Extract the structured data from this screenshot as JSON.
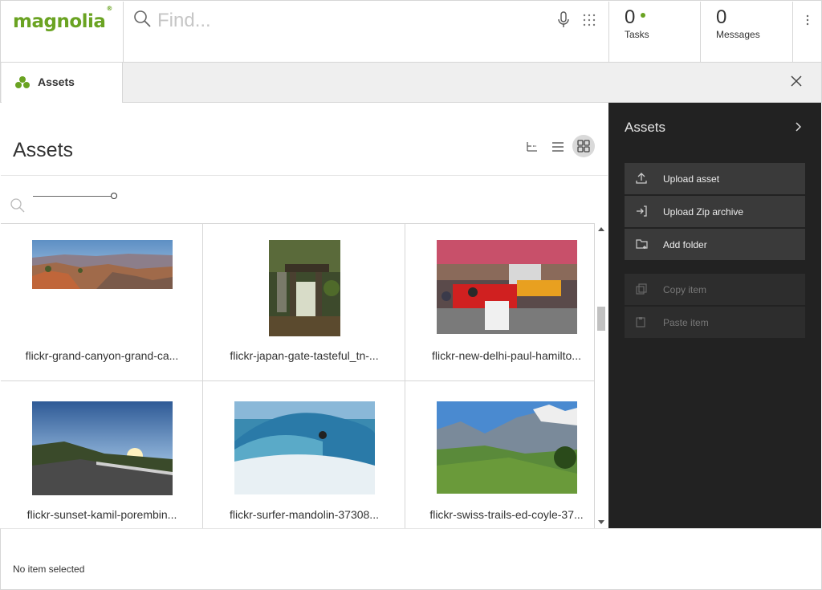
{
  "brand": {
    "logo_text": "magnolia",
    "trademark": "®",
    "accent_color": "#6aa322"
  },
  "search": {
    "placeholder": "Find..."
  },
  "header": {
    "tasks": {
      "count": "0",
      "label": "Tasks"
    },
    "messages": {
      "count": "0",
      "label": "Messages"
    }
  },
  "tab": {
    "label": "Assets",
    "icon": "assets-app-icon"
  },
  "content": {
    "title": "Assets",
    "view_modes": [
      "tree-view-icon",
      "list-view-icon",
      "thumbnail-view-icon"
    ],
    "active_view": "thumbnail-view-icon",
    "items": [
      {
        "name": "flickr-grand-canyon-grand-ca..."
      },
      {
        "name": "flickr-japan-gate-tasteful_tn-..."
      },
      {
        "name": "flickr-new-delhi-paul-hamilto..."
      },
      {
        "name": "flickr-sunset-kamil-porembin..."
      },
      {
        "name": "flickr-surfer-mandolin-37308..."
      },
      {
        "name": "flickr-swiss-trails-ed-coyle-37..."
      }
    ]
  },
  "panel": {
    "title": "Assets",
    "actions": [
      {
        "label": "Upload asset",
        "icon": "upload-icon",
        "enabled": true
      },
      {
        "label": "Upload Zip archive",
        "icon": "import-icon",
        "enabled": true
      },
      {
        "label": "Add folder",
        "icon": "add-folder-icon",
        "enabled": true
      },
      {
        "label": "Copy item",
        "icon": "copy-icon",
        "enabled": false
      },
      {
        "label": "Paste item",
        "icon": "paste-icon",
        "enabled": false
      }
    ]
  },
  "footer": {
    "status": "No item selected"
  }
}
